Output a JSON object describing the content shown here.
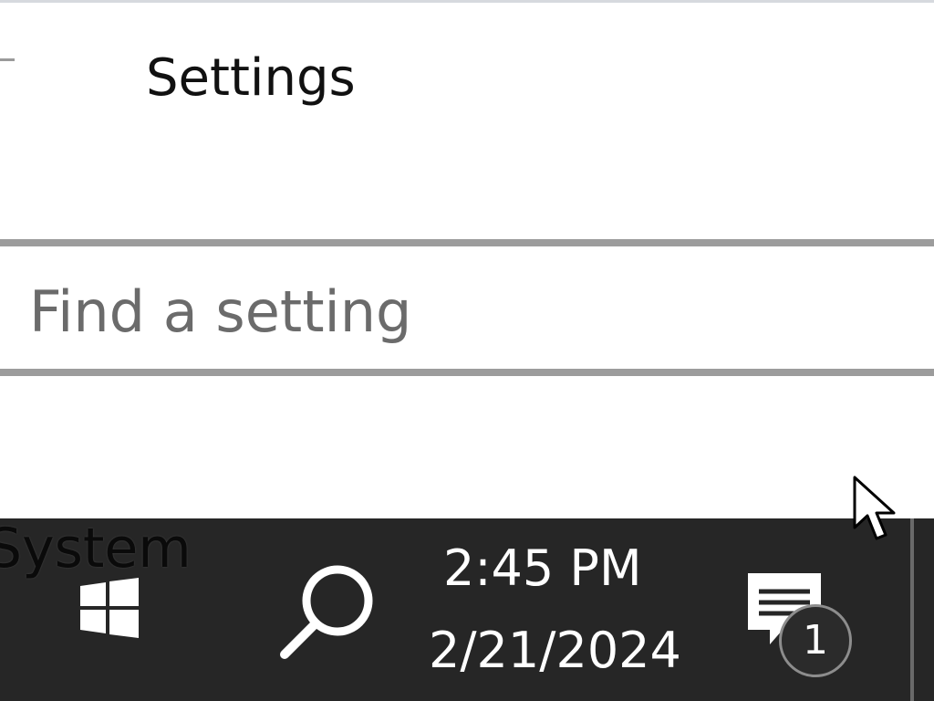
{
  "window": {
    "title": "Settings"
  },
  "search": {
    "placeholder": "Find a setting",
    "value": ""
  },
  "taskbar": {
    "overlay_text": "System",
    "clock_time": "2:45 PM",
    "clock_date": "2/21/2024",
    "notifications_count": "1",
    "icons": [
      "windows-start-icon",
      "search-icon",
      "action-center-icon"
    ]
  },
  "colors": {
    "taskbar_bg": "#262626",
    "input_border": "#9c9c9c",
    "placeholder": "#6b6b6b"
  }
}
